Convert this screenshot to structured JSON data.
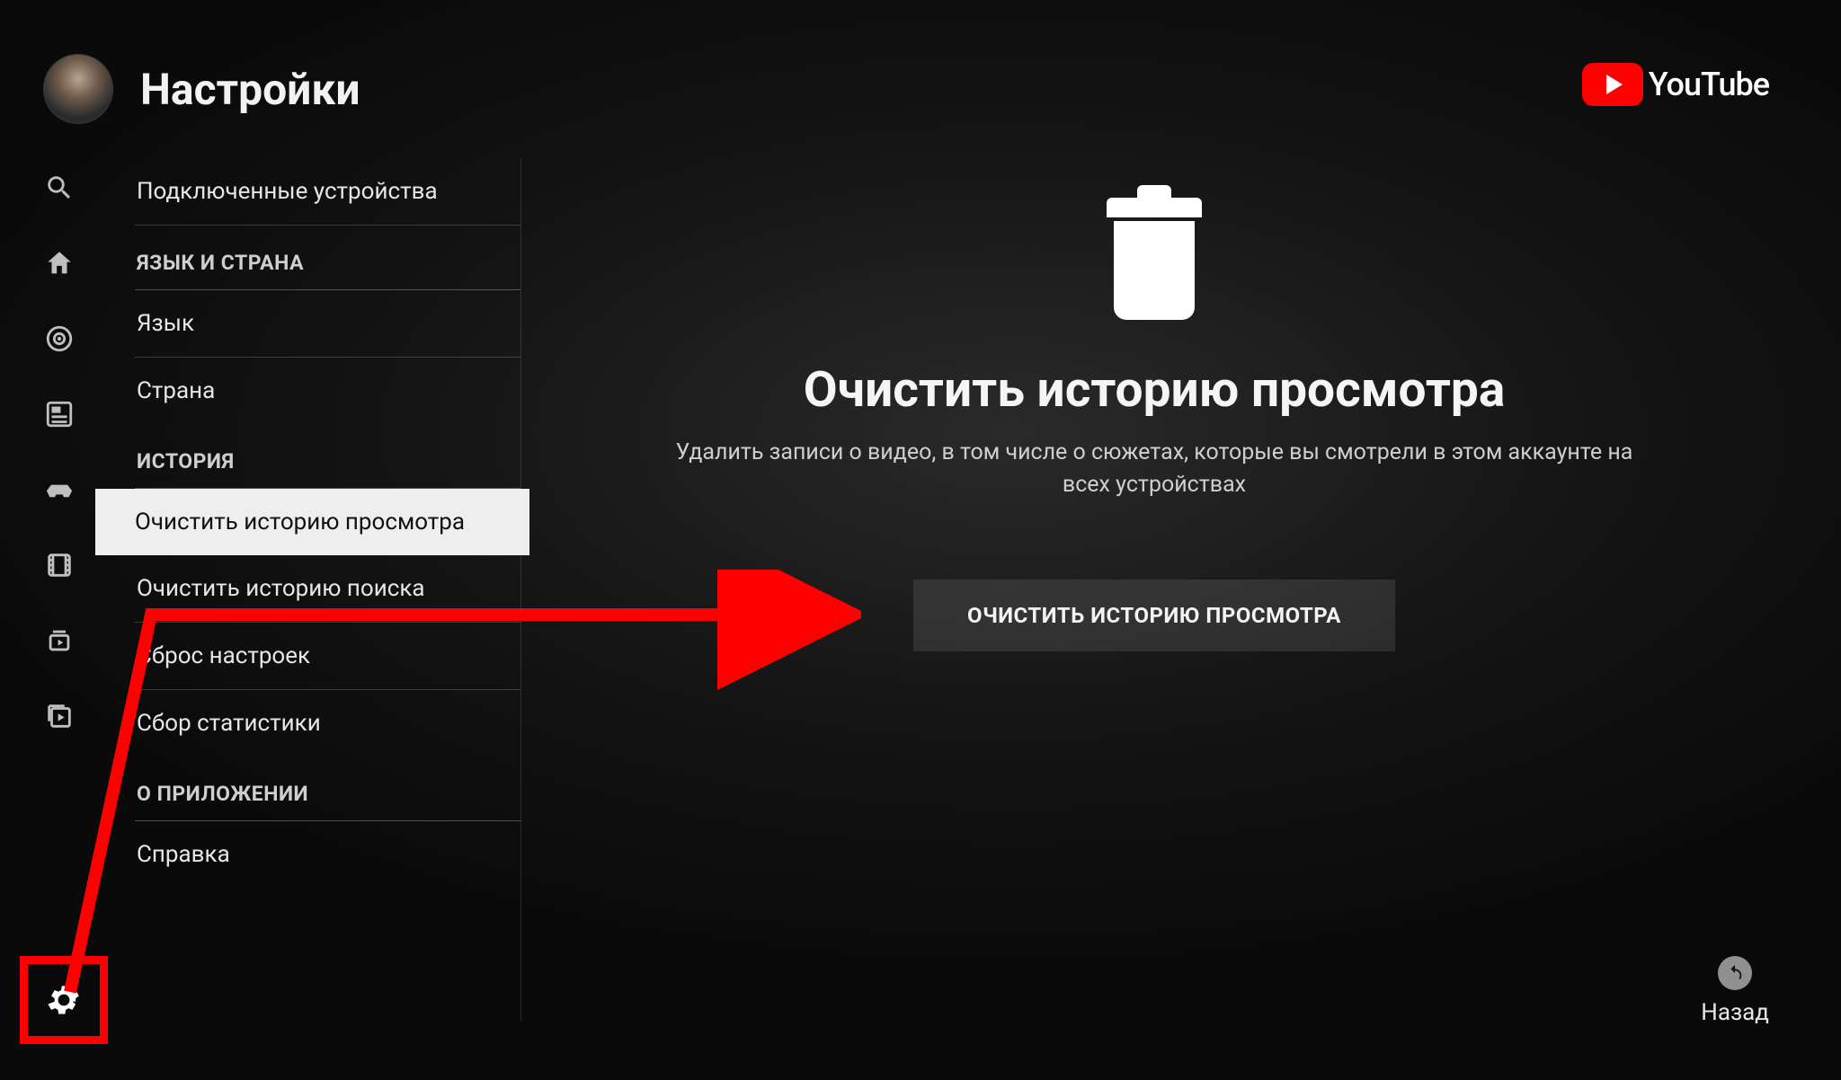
{
  "brand": {
    "name": "YouTube"
  },
  "header": {
    "title": "Настройки"
  },
  "sidebar": {
    "first_item": "Подключенные устройства",
    "sections": [
      {
        "head": "ЯЗЫК И СТРАНА",
        "items": [
          "Язык",
          "Страна"
        ]
      },
      {
        "head": "ИСТОРИЯ",
        "items": [
          "Очистить историю просмотра",
          "Очистить историю поиска",
          "Сброс настроек",
          "Сбор статистики"
        ]
      },
      {
        "head": "О ПРИЛОЖЕНИИ",
        "items": [
          "Справка"
        ]
      }
    ]
  },
  "main": {
    "title": "Очистить историю просмотра",
    "desc": "Удалить записи о видео, в том числе о сюжетах, которые вы смотрели в этом аккаунте на всех устройствах",
    "button": "ОЧИСТИТЬ ИСТОРИЮ ПРОСМОТРА"
  },
  "footer": {
    "back": "Назад"
  },
  "colors": {
    "accent": "#ff0000"
  }
}
